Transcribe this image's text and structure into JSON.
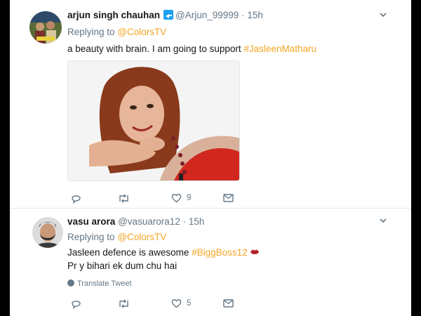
{
  "tweets": [
    {
      "display_name": "arjun singh chauhan",
      "handle": "@Arjun_99999",
      "separator": "·",
      "time": "15h",
      "replying_prefix": "Replying to",
      "replying_handle": "@ColorsTV",
      "text_plain": "a beauty with brain. I am going to support ",
      "hashtag": "#JasleenMatharu",
      "has_photo": true,
      "actions": {
        "reply_count": "",
        "retweet_count": "",
        "like_count": "9"
      }
    },
    {
      "display_name": "vasu arora",
      "handle": "@vasuarora12",
      "separator": "·",
      "time": "15h",
      "replying_prefix": "Replying to",
      "replying_handle": "@ColorsTV",
      "text_line1_plain": "Jasleen defence is awesome ",
      "hashtag": "#BiggBoss12",
      "text_line2": "Pr y bihari ek dum chu hai",
      "translate_label": "Translate Tweet",
      "actions": {
        "reply_count": "",
        "retweet_count": "",
        "like_count": "5"
      }
    }
  ],
  "icons": {
    "verified": "verified-arrow-icon",
    "more": "chevron-down-icon",
    "reply": "reply-icon",
    "retweet": "retweet-icon",
    "like": "heart-icon",
    "dm": "envelope-icon",
    "globe": "globe-icon",
    "emoji": "kiss-lips-emoji"
  },
  "colors": {
    "link": "#f5a623",
    "muted": "#657786",
    "text": "#14171a",
    "divider": "#e1e8ed"
  }
}
